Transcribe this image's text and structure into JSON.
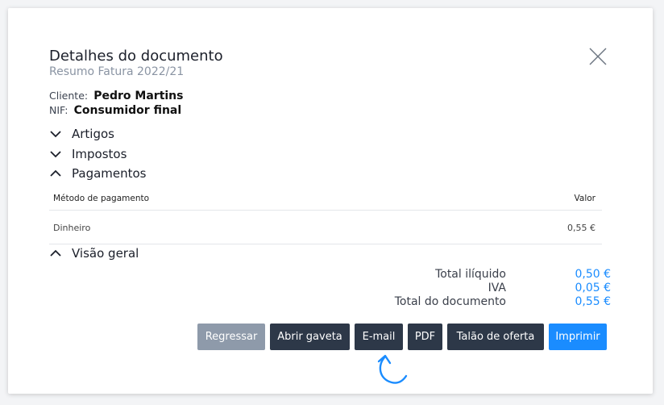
{
  "header": {
    "title": "Detalhes do documento",
    "subtitle": "Resumo Fatura 2022/21"
  },
  "client": {
    "label": "Cliente:",
    "name": "Pedro Martins",
    "nif_label": "NIF:",
    "nif_value": "Consumidor final"
  },
  "sections": {
    "artigos": "Artigos",
    "impostos": "Impostos",
    "pagamentos": "Pagamentos",
    "visao_geral": "Visão geral"
  },
  "payments": {
    "columns": {
      "method": "Método de pagamento",
      "value": "Valor"
    },
    "rows": [
      {
        "method": "Dinheiro",
        "value": "0,55 €"
      }
    ]
  },
  "totals": {
    "rows": [
      {
        "label": "Total ilíquido",
        "value": "0,50 €"
      },
      {
        "label": "IVA",
        "value": "0,05 €"
      },
      {
        "label": "Total do documento",
        "value": "0,55 €"
      }
    ]
  },
  "buttons": {
    "regressar": "Regressar",
    "abrir_gaveta": "Abrir gaveta",
    "email": "E-mail",
    "pdf": "PDF",
    "talao": "Talão de oferta",
    "imprimir": "Imprimir"
  },
  "icons": {
    "close": "close-icon",
    "chevron_down": "chevron-down-icon",
    "chevron_up": "chevron-up-icon",
    "arrow": "curved-arrow-icon"
  },
  "colors": {
    "accent": "#1a8cff",
    "dark_button": "#2d3848",
    "muted_button": "#8e9aaa"
  }
}
